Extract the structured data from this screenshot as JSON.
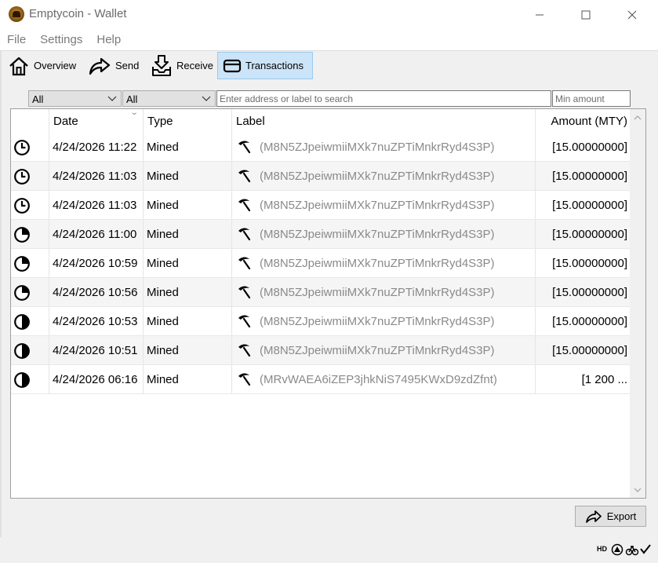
{
  "window": {
    "title": "Emptycoin - Wallet",
    "controls": {
      "minimize": "—",
      "maximize": "☐",
      "close": "✕"
    }
  },
  "menu": [
    "File",
    "Settings",
    "Help"
  ],
  "toolbar": {
    "overview": "Overview",
    "send": "Send",
    "receive": "Receive",
    "transactions": "Transactions",
    "active_tab": "transactions"
  },
  "filters": {
    "date": "All",
    "type": "All",
    "search_placeholder": "Enter address or label to search",
    "min_amount_placeholder": "Min amount"
  },
  "table": {
    "columns": {
      "date": "Date",
      "type": "Type",
      "label": "Label",
      "amount": "Amount (MTY)"
    },
    "sort_column": "date",
    "rows": [
      {
        "status_icon": "clock-icon",
        "date": "4/24/2026 11:22",
        "type": "Mined",
        "type_icon": "pickaxe-icon",
        "label": "(M8N5ZJpeiwmiiMXk7nuZPTiMnkrRyd4S3P)",
        "amount": "[15.00000000]"
      },
      {
        "status_icon": "clock-icon",
        "date": "4/24/2026 11:03",
        "type": "Mined",
        "type_icon": "pickaxe-icon",
        "label": "(M8N5ZJpeiwmiiMXk7nuZPTiMnkrRyd4S3P)",
        "amount": "[15.00000000]"
      },
      {
        "status_icon": "clock-icon",
        "date": "4/24/2026 11:03",
        "type": "Mined",
        "type_icon": "pickaxe-icon",
        "label": "(M8N5ZJpeiwmiiMXk7nuZPTiMnkrRyd4S3P)",
        "amount": "[15.00000000]"
      },
      {
        "status_icon": "pie-quarter-icon",
        "date": "4/24/2026 11:00",
        "type": "Mined",
        "type_icon": "pickaxe-icon",
        "label": "(M8N5ZJpeiwmiiMXk7nuZPTiMnkrRyd4S3P)",
        "amount": "[15.00000000]"
      },
      {
        "status_icon": "pie-quarter-icon",
        "date": "4/24/2026 10:59",
        "type": "Mined",
        "type_icon": "pickaxe-icon",
        "label": "(M8N5ZJpeiwmiiMXk7nuZPTiMnkrRyd4S3P)",
        "amount": "[15.00000000]"
      },
      {
        "status_icon": "pie-quarter-icon",
        "date": "4/24/2026 10:56",
        "type": "Mined",
        "type_icon": "pickaxe-icon",
        "label": "(M8N5ZJpeiwmiiMXk7nuZPTiMnkrRyd4S3P)",
        "amount": "[15.00000000]"
      },
      {
        "status_icon": "pie-half-icon",
        "date": "4/24/2026 10:53",
        "type": "Mined",
        "type_icon": "pickaxe-icon",
        "label": "(M8N5ZJpeiwmiiMXk7nuZPTiMnkrRyd4S3P)",
        "amount": "[15.00000000]"
      },
      {
        "status_icon": "pie-half-icon",
        "date": "4/24/2026 10:51",
        "type": "Mined",
        "type_icon": "pickaxe-icon",
        "label": "(M8N5ZJpeiwmiiMXk7nuZPTiMnkrRyd4S3P)",
        "amount": "[15.00000000]"
      },
      {
        "status_icon": "pie-half-icon",
        "date": "4/24/2026 06:16",
        "type": "Mined",
        "type_icon": "pickaxe-icon",
        "label": "(MRvWAEA6iZEP3jhkNiS7495KWxD9zdZfnt)",
        "amount": "[1 200 ..."
      }
    ]
  },
  "export_button": "Export",
  "statusbar": {
    "hd_label": "HD",
    "icons": [
      "network-icon",
      "sync-icon",
      "synced-check-icon"
    ]
  },
  "colors": {
    "active_tab_bg": "#cce4f7",
    "active_tab_border": "#99c9ef",
    "label_text": "#8a8a8a",
    "alt_row": "#f5f5f5"
  }
}
